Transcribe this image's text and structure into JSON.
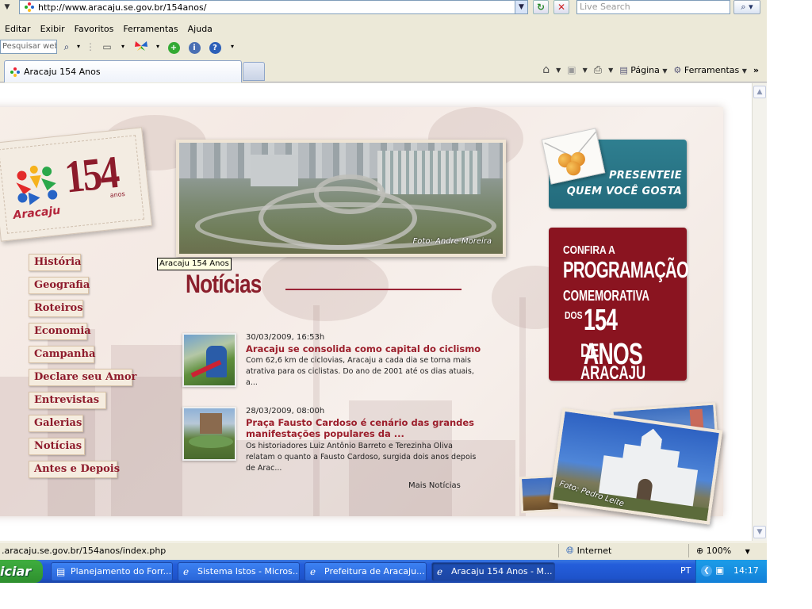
{
  "browser": {
    "address_url": "http://www.aracaju.se.gov.br/154anos/",
    "search_placeholder": "Live Search",
    "menu": [
      "Editar",
      "Exibir",
      "Favoritos",
      "Ferramentas",
      "Ajuda"
    ],
    "toolbar_search_placeholder": "Pesquisar web",
    "tab_title": "Aracaju 154 Anos",
    "cmd_page": "Página",
    "cmd_tools": "Ferramentas",
    "status_url": ".aracaju.se.gov.br/154anos/index.php",
    "status_zone": "Internet",
    "zoom": "100%"
  },
  "site": {
    "logo_number": "154",
    "logo_anos": "anos",
    "logo_city": "Aracaju",
    "aerial_photo_credit": "Foto: Andre Moreira",
    "tooltip": "Aracaju 154 Anos",
    "nav": [
      "História",
      "Geografia",
      "Roteiros",
      "Economia",
      "Campanha",
      "Declare seu Amor",
      "Entrevistas",
      "Galerias",
      "Notícias",
      "Antes e Depois"
    ],
    "news_heading": "Notícias",
    "news": [
      {
        "date": "30/03/2009, 16:53h",
        "headline": "Aracaju se consolida como capital do ciclismo",
        "summary": "Com 62,6 km de ciclovias, Aracaju a cada dia se torna mais atrativa para os ciclistas. Do ano de 2001 até os dias atuais, a..."
      },
      {
        "date": "28/03/2009, 08:00h",
        "headline": "Praça Fausto Cardoso é cenário das grandes manifestações populares da ...",
        "summary": "Os historiadores Luiz Antônio Barreto e Terezinha Oliva relatam o quanto a Fausto Cardoso, surgida dois anos depois de Arac..."
      }
    ],
    "more_news": "Mais Notícias",
    "promo_gift": [
      "PRESENTEIE",
      "QUEM VOCÊ GOSTA"
    ],
    "promo_program": [
      "CONFIRA A",
      "PROGRAMAÇÃO",
      "COMEMORATIVA",
      "DOS",
      "154 ANOS",
      "DE ARACAJU"
    ],
    "church_photo_credit": "Foto: Pedro Leite"
  },
  "taskbar": {
    "start_label": "iciar",
    "tasks": [
      "Planejamento do Forr...",
      "Sistema Istos - Micros...",
      "Prefeitura de Aracaju...",
      "Aracaju 154 Anos - M..."
    ],
    "lang": "PT",
    "clock": "14:17"
  },
  "colors": {
    "brand_red": "#8c1b2b",
    "promo_teal": "#2a7587",
    "promo_red": "#8a1420",
    "taskbar_blue": "#245edb"
  }
}
